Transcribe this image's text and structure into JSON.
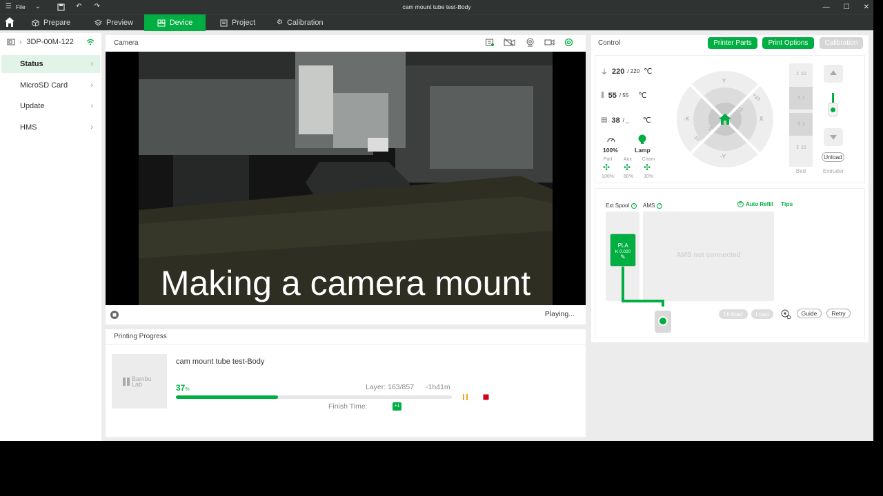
{
  "titlebar": {
    "file_label": "File",
    "window_title": "cam mount  tube test-Body"
  },
  "menu": {
    "tabs": [
      {
        "label": "Prepare",
        "icon": "cube-icon"
      },
      {
        "label": "Preview",
        "icon": "layers-icon"
      },
      {
        "label": "Device",
        "icon": "device-icon"
      },
      {
        "label": "Project",
        "icon": "project-icon"
      },
      {
        "label": "Calibration",
        "icon": "gear-icon"
      }
    ],
    "active_tab": "Device"
  },
  "sidebar": {
    "printer_name": "3DP-00M-122",
    "items": [
      {
        "label": "Status"
      },
      {
        "label": "MicroSD Card"
      },
      {
        "label": "Update"
      },
      {
        "label": "HMS"
      }
    ]
  },
  "camera": {
    "title": "Camera",
    "subtitle": "Making a camera mount",
    "status": "Playing..."
  },
  "progress": {
    "title": "Printing Progress",
    "job_name": "cam mount  tube test-Body",
    "percent": "37",
    "percent_unit": "%",
    "percent_value": 37,
    "layer": "Layer: 163/857",
    "remaining": "-1h41m",
    "finish_label": "Finish Time:",
    "finish_badge": "+1",
    "thumb_logo_top": "Bambu",
    "thumb_logo_bottom": "Lab"
  },
  "control": {
    "title": "Control",
    "buttons": {
      "printer_parts": "Printer Parts",
      "print_options": "Print Options",
      "calibration": "Calibration"
    },
    "nozzle": {
      "current": "220",
      "target": "/ 220",
      "unit": "℃"
    },
    "bed": {
      "current": "55",
      "target": "/ 55",
      "unit": "℃"
    },
    "chamber": {
      "current": "38",
      "target": "/ _",
      "unit": "℃"
    },
    "speed": "100%",
    "lamp": "Lamp",
    "fans": [
      {
        "label": "Part",
        "value": "100%"
      },
      {
        "label": "Aux",
        "value": "80%"
      },
      {
        "label": "Cham",
        "value": "30%"
      }
    ],
    "jog": {
      "y_plus": "Y",
      "y_minus": "-Y",
      "x_plus": "X",
      "x_minus": "-X",
      "plus10": "+10",
      "plus1": "+1",
      "minus1": "-1",
      "minus10": "-10"
    },
    "bed_steps": [
      "10",
      "1",
      "1",
      "10"
    ],
    "bed_label": "Bed",
    "extruder_label": "Extruder",
    "unload_small": "Unload"
  },
  "ams": {
    "ext_spool": "Ext Spool",
    "ams_label": "AMS",
    "auto_refill": "Auto Refill",
    "tips": "Tips",
    "filament_type": "PLA",
    "filament_k": "K 0.020",
    "not_connected": "AMS not connected",
    "unload": "Unload",
    "load": "Load",
    "guide": "Guide",
    "retry": "Retry"
  },
  "colors": {
    "accent": "#00ae42",
    "stop": "#d0021b",
    "pause": "#f5a623"
  }
}
